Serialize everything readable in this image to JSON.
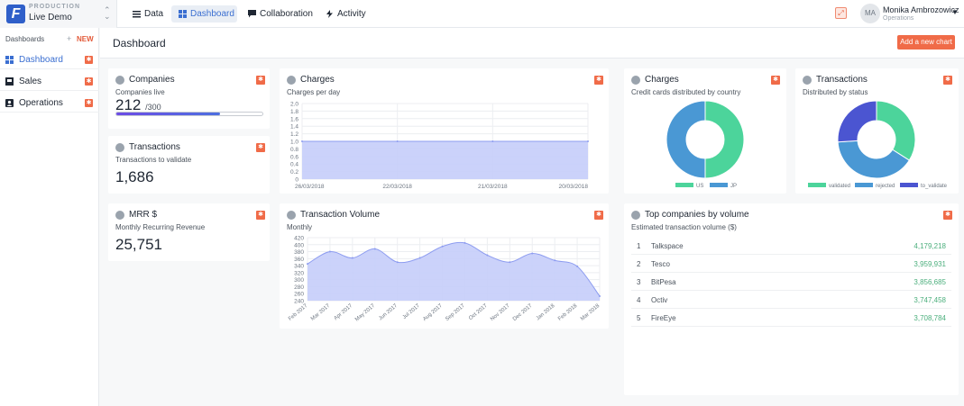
{
  "env": {
    "label": "PRODUCTION",
    "name": "Live Demo",
    "logo_letter": "F"
  },
  "nav": [
    {
      "label": "Data",
      "icon": "list-icon"
    },
    {
      "label": "Dashboard",
      "icon": "grid-icon"
    },
    {
      "label": "Collaboration",
      "icon": "chat-icon"
    },
    {
      "label": "Activity",
      "icon": "lightning-icon"
    }
  ],
  "user": {
    "initials": "MA",
    "name": "Monika Ambrozowicz",
    "role": "Operations"
  },
  "sidebar": {
    "heading": "Dashboards",
    "plus": "+",
    "new_label": "NEW",
    "items": [
      {
        "label": "Dashboard",
        "icon": "grid-icon"
      },
      {
        "label": "Sales",
        "icon": "box-icon"
      },
      {
        "label": "Operations",
        "icon": "person-icon"
      }
    ]
  },
  "page": {
    "title": "Dashboard",
    "add_button": "Add a new chart"
  },
  "cards": {
    "companies": {
      "title": "Companies",
      "subtitle": "Companies live",
      "value": "212",
      "suffix": "/300",
      "progress": 0.707
    },
    "transactions": {
      "title": "Transactions",
      "subtitle": "Transactions to validate",
      "value": "1,686"
    },
    "mrr": {
      "title": "MRR $",
      "subtitle": "Monthly Recurring Revenue",
      "value": "25,751"
    },
    "charges_line": {
      "title": "Charges",
      "subtitle": "Charges per day"
    },
    "charges_donut": {
      "title": "Charges",
      "subtitle": "Credit cards distributed by country"
    },
    "transactions_donut": {
      "title": "Transactions",
      "subtitle": "Distributed by status"
    },
    "volume": {
      "title": "Transaction Volume",
      "subtitle": "Monthly"
    },
    "top": {
      "title": "Top companies by volume",
      "subtitle": "Estimated transaction volume ($)",
      "rows": [
        {
          "rank": "1",
          "name": "Talkspace",
          "value": "4,179,218"
        },
        {
          "rank": "2",
          "name": "Tesco",
          "value": "3,959,931"
        },
        {
          "rank": "3",
          "name": "BitPesa",
          "value": "3,856,685"
        },
        {
          "rank": "4",
          "name": "Octiv",
          "value": "3,747,458"
        },
        {
          "rank": "5",
          "name": "FireEye",
          "value": "3,708,784"
        }
      ]
    }
  },
  "colors": {
    "accent": "#f06b48",
    "brand": "#2f5fc9",
    "green": "#4cd49b",
    "blue": "#4a98d4",
    "indigo": "#4b55d1",
    "area": "#c5cdf9"
  },
  "chart_data": [
    {
      "type": "area",
      "title": "Charges",
      "subtitle": "Charges per day",
      "categories": [
        "26/03/2018",
        "22/03/2018",
        "21/03/2018",
        "20/03/2018"
      ],
      "values": [
        1.0,
        1.0,
        1.0,
        1.0
      ],
      "ylim": [
        0,
        2.0
      ],
      "yticks": [
        "0",
        "0.2",
        "0.4",
        "0.6",
        "0.8",
        "1.0",
        "1.2",
        "1.4",
        "1.6",
        "1.8",
        "2.0"
      ],
      "grid": true
    },
    {
      "type": "pie",
      "title": "Charges",
      "subtitle": "Credit cards distributed by country",
      "labels": [
        "US",
        "JP"
      ],
      "values": [
        50,
        50
      ],
      "colors": [
        "#4cd49b",
        "#4a98d4"
      ],
      "legend": "bottom"
    },
    {
      "type": "pie",
      "title": "Transactions",
      "subtitle": "Distributed by status",
      "labels": [
        "validated",
        "rejected",
        "to_validate"
      ],
      "values": [
        34,
        40,
        26
      ],
      "colors": [
        "#4cd49b",
        "#4a98d4",
        "#4b55d1"
      ],
      "legend": "bottom"
    },
    {
      "type": "area",
      "title": "Transaction Volume",
      "subtitle": "Monthly",
      "categories": [
        "Feb 2017",
        "Mar 2017",
        "Apr 2017",
        "May 2017",
        "Jun 2017",
        "Jul 2017",
        "Aug 2017",
        "Sep 2017",
        "Oct 2017",
        "Nov 2017",
        "Dec 2017",
        "Jan 2018",
        "Feb 2018",
        "Mar 2018"
      ],
      "values": [
        345,
        380,
        362,
        388,
        350,
        362,
        395,
        405,
        370,
        350,
        375,
        355,
        338,
        253
      ],
      "ylim": [
        240,
        420
      ],
      "yticks": [
        "240",
        "260",
        "280",
        "300",
        "320",
        "340",
        "360",
        "380",
        "400",
        "420"
      ],
      "grid": true
    }
  ]
}
